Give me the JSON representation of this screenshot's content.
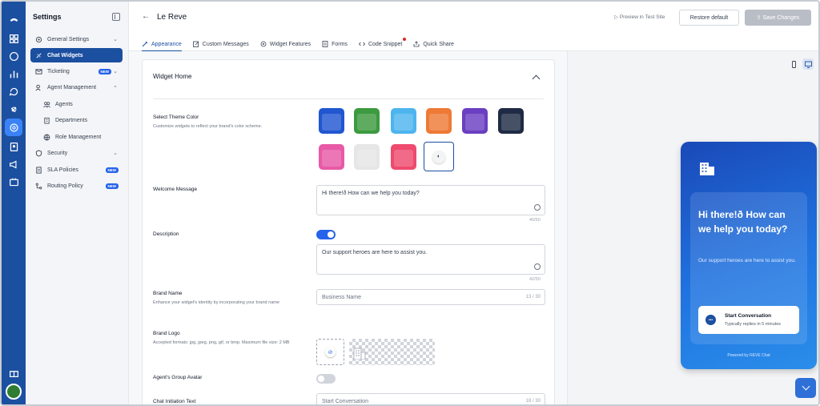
{
  "sidebar": {
    "title": "Settings",
    "items": [
      {
        "label": "General Settings",
        "icon": "settings-icon"
      },
      {
        "label": "Chat Widgets",
        "icon": "widget-icon"
      },
      {
        "label": "Ticketing",
        "icon": "mail-icon",
        "badge": "NEW"
      },
      {
        "label": "Agent Management",
        "icon": "agent-icon"
      },
      {
        "label": "Agents",
        "icon": "agents-icon"
      },
      {
        "label": "Departments",
        "icon": "building-icon"
      },
      {
        "label": "Role Management",
        "icon": "globe-icon"
      },
      {
        "label": "Security",
        "icon": "shield-icon"
      },
      {
        "label": "SLA Policies",
        "icon": "document-icon",
        "badge": "NEW"
      },
      {
        "label": "Routing Policy",
        "icon": "routing-icon",
        "badge": "NEW"
      }
    ]
  },
  "header": {
    "title": "Le Reve",
    "preview_label": "Preview in Test Site",
    "restore_label": "Restore default",
    "save_label": "Save Changes"
  },
  "tabs": [
    {
      "label": "Appearance",
      "active": true
    },
    {
      "label": "Custom Messages"
    },
    {
      "label": "Widget Features"
    },
    {
      "label": "Forms"
    },
    {
      "label": "Code Snippet",
      "dot": true
    },
    {
      "label": "Quick Share"
    }
  ],
  "form": {
    "section_title": "Widget Home",
    "theme": {
      "label": "Select Theme Color",
      "hint": "Customize widgets to reflect your brand's color scheme.",
      "colors": [
        "#2156d1",
        "#3c9a3f",
        "#4db5ee",
        "#ee7a36",
        "#6a3fc1",
        "#1f2b45",
        "#e85aa6",
        "#e6e6e6",
        "#ee4b6e"
      ]
    },
    "welcome": {
      "label": "Welcome Message",
      "value": "Hi there!ð How can we help you today?",
      "counter": "40/50"
    },
    "description": {
      "label": "Description",
      "enabled": true,
      "value": "Our support heroes are here to assist you.",
      "counter": "42/50"
    },
    "brand_name": {
      "label": "Brand Name",
      "hint": "Enhance your widget's identity by incorporating your brand name",
      "placeholder": "Business Name",
      "counter": "13 / 30"
    },
    "brand_logo": {
      "label": "Brand Logo",
      "hint": "Accepted formats: jpg, jpeg, png, gif, or bmp. Maximum file size: 2 MB"
    },
    "group_avatar": {
      "label": "Agent's Group Avatar",
      "enabled": false
    },
    "initiation": {
      "label": "Chat Initiation Text",
      "placeholder": "Start Conversation",
      "counter": "18 / 30"
    }
  },
  "preview": {
    "greeting": "Hi there!ð How can we help you today?",
    "description": "Our support heroes are here to assist you.",
    "start_title": "Start Conversation",
    "start_sub": "Typically replies in 5 minutes",
    "powered": "Powered by REVE Chat"
  }
}
